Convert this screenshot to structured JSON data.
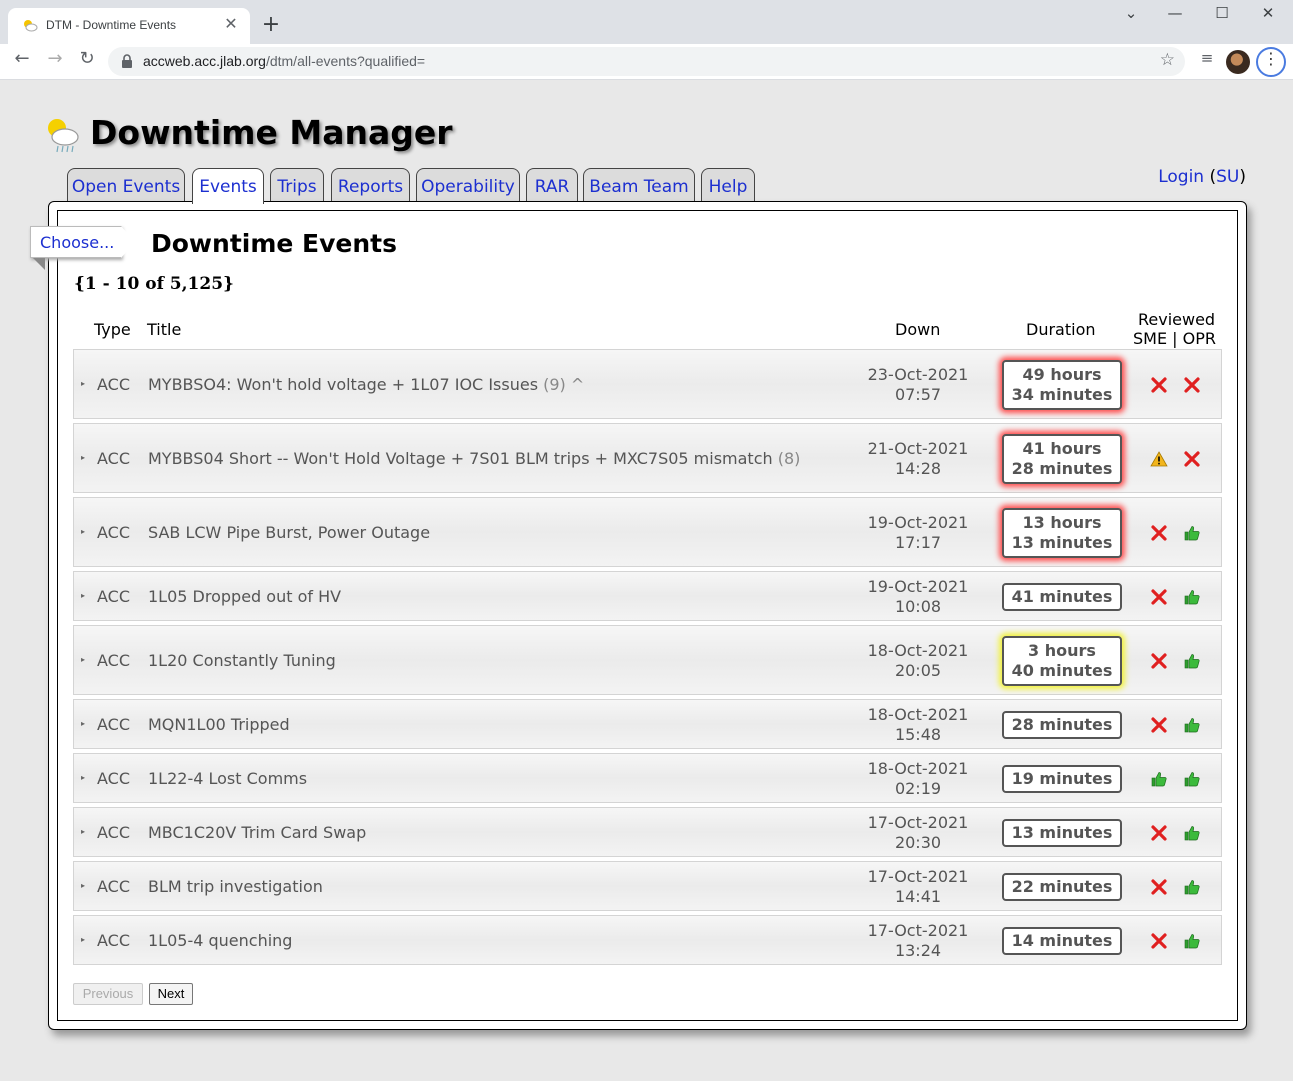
{
  "browser": {
    "tab_title": "DTM - Downtime Events",
    "new_tab": "+",
    "url_host": "accweb.acc.jlab.org",
    "url_path": "/dtm/all-events?qualified="
  },
  "app": {
    "title": "Downtime Manager",
    "login_label": "Login",
    "su_label": "SU",
    "nav_tabs": [
      "Open Events",
      "Events",
      "Trips",
      "Reports",
      "Operability",
      "RAR",
      "Beam Team",
      "Help"
    ],
    "active_tab": "Events"
  },
  "page": {
    "choose_label": "Choose...",
    "heading": "Downtime Events",
    "paging_info": "{1 - 10 of 5,125}"
  },
  "table": {
    "headers": {
      "type": "Type",
      "title": "Title",
      "down": "Down",
      "duration": "Duration",
      "reviewed": "Reviewed",
      "sme_opr": "SME | OPR"
    },
    "rows": [
      {
        "type": "ACC",
        "title": "MYBBSO4: Won't hold voltage + 1L07 IOC Issues",
        "count": "(9)",
        "suffix": "^",
        "down_date": "23-Oct-2021",
        "down_time": "07:57",
        "duration": [
          "49 hours",
          "34 minutes"
        ],
        "highlight": "red",
        "sme": "x-icon",
        "opr": "x-icon"
      },
      {
        "type": "ACC",
        "title": "MYBBS04 Short -- Won't Hold Voltage + 7S01 BLM trips + MXC7S05 mismatch",
        "count": "(8)",
        "suffix": "",
        "down_date": "21-Oct-2021",
        "down_time": "14:28",
        "duration": [
          "41 hours",
          "28 minutes"
        ],
        "highlight": "red",
        "sme": "warning-icon",
        "opr": "x-icon"
      },
      {
        "type": "ACC",
        "title": "SAB LCW Pipe Burst, Power Outage",
        "count": "",
        "suffix": "",
        "down_date": "19-Oct-2021",
        "down_time": "17:17",
        "duration": [
          "13 hours",
          "13 minutes"
        ],
        "highlight": "red",
        "sme": "x-icon",
        "opr": "thumbs-up-icon"
      },
      {
        "type": "ACC",
        "title": "1L05 Dropped out of HV",
        "count": "",
        "suffix": "",
        "down_date": "19-Oct-2021",
        "down_time": "10:08",
        "duration": [
          "41 minutes"
        ],
        "highlight": "none",
        "sme": "x-icon",
        "opr": "thumbs-up-icon"
      },
      {
        "type": "ACC",
        "title": "1L20 Constantly Tuning",
        "count": "",
        "suffix": "",
        "down_date": "18-Oct-2021",
        "down_time": "20:05",
        "duration": [
          "3 hours",
          "40 minutes"
        ],
        "highlight": "yellow",
        "sme": "x-icon",
        "opr": "thumbs-up-icon"
      },
      {
        "type": "ACC",
        "title": "MQN1L00 Tripped",
        "count": "",
        "suffix": "",
        "down_date": "18-Oct-2021",
        "down_time": "15:48",
        "duration": [
          "28 minutes"
        ],
        "highlight": "none",
        "sme": "x-icon",
        "opr": "thumbs-up-icon"
      },
      {
        "type": "ACC",
        "title": "1L22-4 Lost Comms",
        "count": "",
        "suffix": "",
        "down_date": "18-Oct-2021",
        "down_time": "02:19",
        "duration": [
          "19 minutes"
        ],
        "highlight": "none",
        "sme": "thumbs-up-icon",
        "opr": "thumbs-up-icon"
      },
      {
        "type": "ACC",
        "title": "MBC1C20V Trim Card Swap",
        "count": "",
        "suffix": "",
        "down_date": "17-Oct-2021",
        "down_time": "20:30",
        "duration": [
          "13 minutes"
        ],
        "highlight": "none",
        "sme": "x-icon",
        "opr": "thumbs-up-icon"
      },
      {
        "type": "ACC",
        "title": "BLM trip investigation",
        "count": "",
        "suffix": "",
        "down_date": "17-Oct-2021",
        "down_time": "14:41",
        "duration": [
          "22 minutes"
        ],
        "highlight": "none",
        "sme": "x-icon",
        "opr": "thumbs-up-icon"
      },
      {
        "type": "ACC",
        "title": "1L05-4 quenching",
        "count": "",
        "suffix": "",
        "down_date": "17-Oct-2021",
        "down_time": "13:24",
        "duration": [
          "14 minutes"
        ],
        "highlight": "none",
        "sme": "x-icon",
        "opr": "thumbs-up-icon"
      }
    ]
  },
  "pagination": {
    "previous_label": "Previous",
    "next_label": "Next"
  }
}
